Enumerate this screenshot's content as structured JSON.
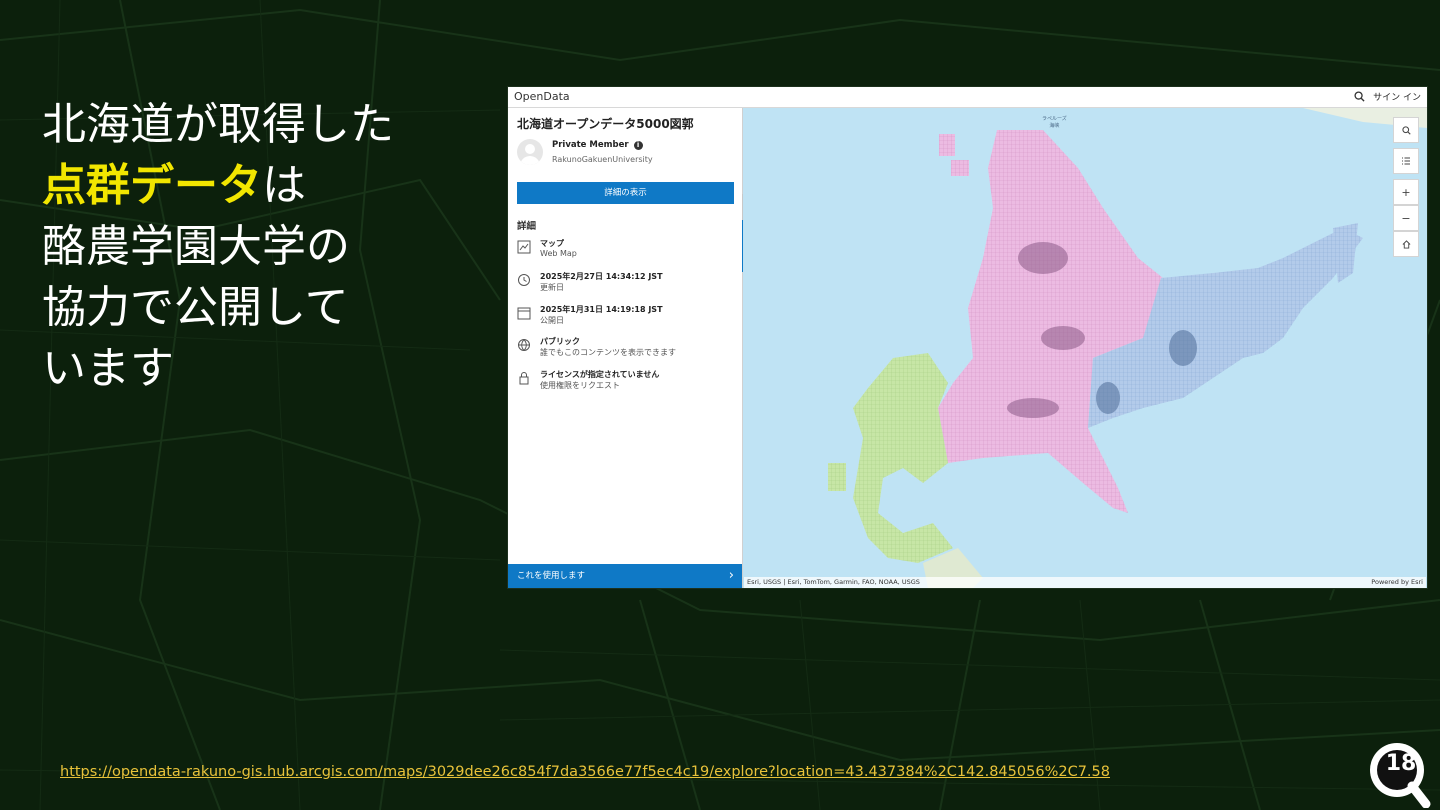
{
  "slide": {
    "heading_line1": "北海道が取得した",
    "heading_highlight": "点群データ",
    "heading_after_highlight": "は",
    "heading_line3": "酪農学園大学の",
    "heading_line4": "協力で公開して",
    "heading_line5": "います",
    "url": "https://opendata-rakuno-gis.hub.arcgis.com/maps/3029dee26c854f7da3566e77f5ec4c19/explore?location=43.437384%2C142.845056%2C7.58",
    "page_number": "18",
    "highlight_color": "#f2e600",
    "link_color": "#e8c23a"
  },
  "app": {
    "brand": "OpenData",
    "signin_label": "サイン イン",
    "search_icon": "search-icon"
  },
  "panel": {
    "title": "北海道オープンデータ5000図郭",
    "owner_role": "Private Member",
    "owner_org": "RakunoGakuenUniversity",
    "details_button": "詳細の表示",
    "section_title": "詳細",
    "items": [
      {
        "icon": "map-icon",
        "title": "マップ",
        "sub": "Web Map"
      },
      {
        "icon": "history-icon",
        "title": "2025年2月27日 14:34:12 JST",
        "sub": "更新日"
      },
      {
        "icon": "calendar-icon",
        "title": "2025年1月31日 14:19:18 JST",
        "sub": "公開日"
      },
      {
        "icon": "globe-icon",
        "title": "パブリック",
        "sub": "誰でもこのコンテンツを表示できます"
      },
      {
        "icon": "lock-icon",
        "title": "ライセンスが指定されていません",
        "sub": "使用権限をリクエスト"
      }
    ],
    "use_button": "これを使用します",
    "accent_color": "#0f79c6"
  },
  "map": {
    "attribution_left": "Esri, USGS | Esri, TomTom, Garmin, FAO, NOAA, USGS",
    "attribution_right": "Powered by Esri",
    "label_line1": "ラペルーズ",
    "label_line2": "海峡",
    "tools": [
      "search-icon",
      "legend-icon",
      "zoom-in-icon",
      "zoom-out-icon",
      "home-icon"
    ],
    "zoom_in": "+",
    "zoom_out": "−",
    "colors": {
      "water": "#bfe3f4",
      "west": "#bfe0a0",
      "central": "#e9b1de",
      "east": "#a8c4e6"
    }
  }
}
